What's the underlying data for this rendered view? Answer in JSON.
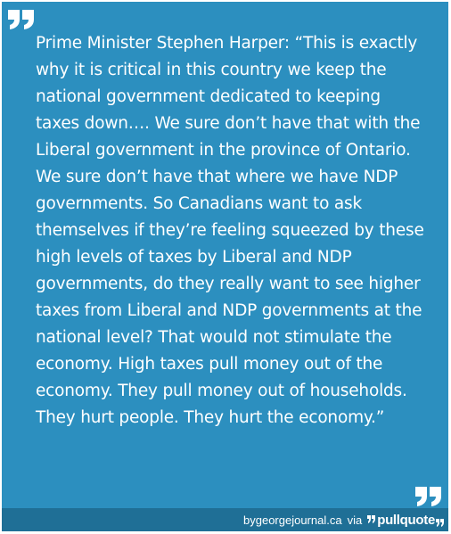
{
  "quote": {
    "text": "Prime Minister Stephen Harper: “This is exactly why it is critical in this country we keep the national government dedicated to keeping taxes down…. We sure don’t have that with the Liberal government in the province of Ontario. We sure don’t have that where we have NDP governments. So Canadians want to ask themselves if they’re feeling squeezed by these high levels of taxes by Liberal and NDP governments, do they really want to see higher taxes from Liberal and NDP governments at the national level? That would not stimulate the economy. High taxes pull money out of the economy. They pull money out of households. They hurt people. They hurt the economy.”"
  },
  "footer": {
    "source": "bygeorgejournal.ca",
    "via": "via",
    "brand": "pullquote"
  },
  "colors": {
    "card_background": "#2c8fbf",
    "footer_background": "#1f6f96",
    "text": "#ffffff"
  },
  "icons": {
    "open_quote": "open-quote-icon",
    "close_quote": "close-quote-icon"
  }
}
